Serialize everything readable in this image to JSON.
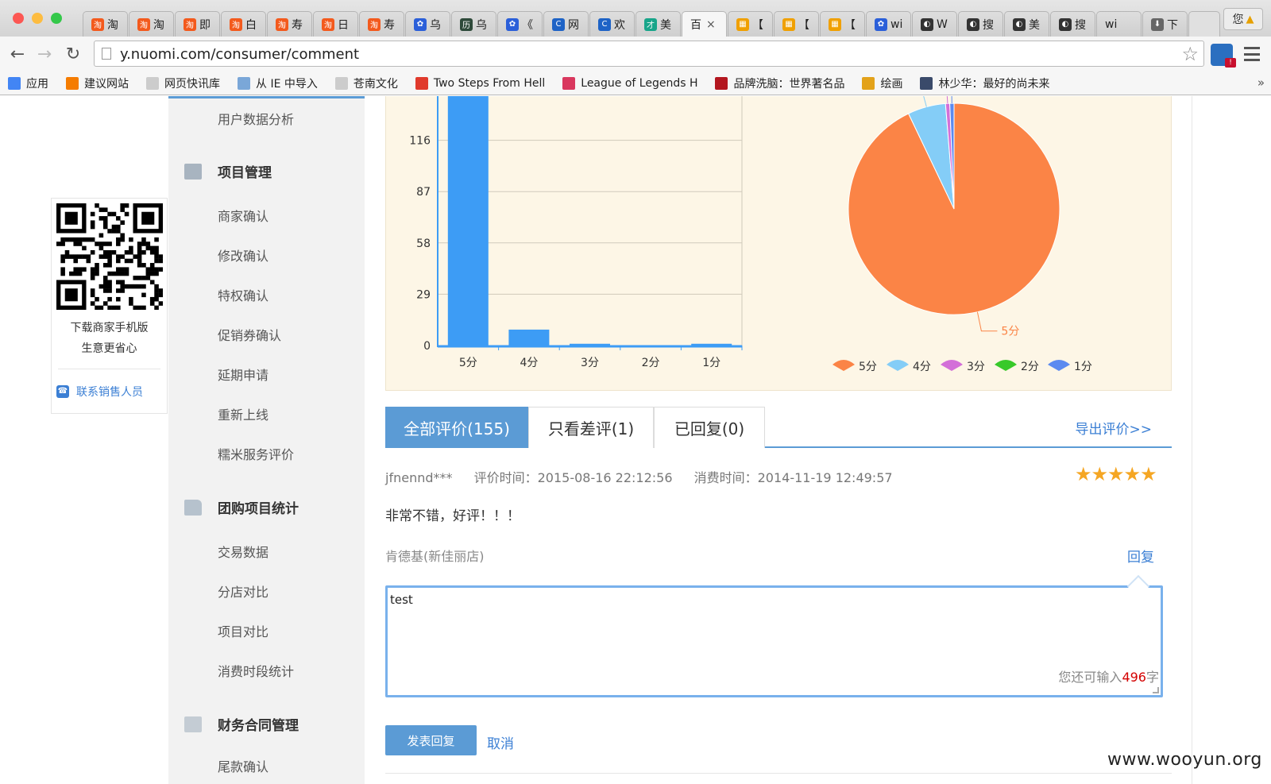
{
  "browser": {
    "tabs": [
      {
        "label": "淘",
        "fav_color": "#f35a1d",
        "fav_glyph": "淘"
      },
      {
        "label": "淘",
        "fav_color": "#f35a1d",
        "fav_glyph": "淘"
      },
      {
        "label": "即",
        "fav_color": "#f35a1d",
        "fav_glyph": "淘"
      },
      {
        "label": "白",
        "fav_color": "#f35a1d",
        "fav_glyph": "淘"
      },
      {
        "label": "寿",
        "fav_color": "#f35a1d",
        "fav_glyph": "淘"
      },
      {
        "label": "日",
        "fav_color": "#f35a1d",
        "fav_glyph": "淘"
      },
      {
        "label": "寿",
        "fav_color": "#f35a1d",
        "fav_glyph": "淘"
      },
      {
        "label": "乌",
        "fav_color": "#2b5fd9",
        "fav_glyph": "✿"
      },
      {
        "label": "乌",
        "fav_color": "#2e4a3a",
        "fav_glyph": "历"
      },
      {
        "label": "《",
        "fav_color": "#2b5fd9",
        "fav_glyph": "✿"
      },
      {
        "label": "网",
        "fav_color": "#1e63c6",
        "fav_glyph": "C"
      },
      {
        "label": "欢",
        "fav_color": "#1e63c6",
        "fav_glyph": "C"
      },
      {
        "label": "美",
        "fav_color": "#18a58a",
        "fav_glyph": "才"
      },
      {
        "label": "百",
        "fav_color": "",
        "fav_glyph": "",
        "active": true,
        "close": "×"
      },
      {
        "label": "【",
        "fav_color": "#f0a000",
        "fav_glyph": "▦"
      },
      {
        "label": "【",
        "fav_color": "#f0a000",
        "fav_glyph": "▦"
      },
      {
        "label": "【",
        "fav_color": "#f0a000",
        "fav_glyph": "▦"
      },
      {
        "label": "wi",
        "fav_color": "#2b5fd9",
        "fav_glyph": "✿"
      },
      {
        "label": "W",
        "fav_color": "#333333",
        "fav_glyph": "◐"
      },
      {
        "label": "搜",
        "fav_color": "#333333",
        "fav_glyph": "◐"
      },
      {
        "label": "美",
        "fav_color": "#333333",
        "fav_glyph": "◐"
      },
      {
        "label": "搜",
        "fav_color": "#333333",
        "fav_glyph": "◐"
      },
      {
        "label": "wi",
        "fav_color": "",
        "fav_glyph": ""
      },
      {
        "label": "下",
        "fav_color": "#666666",
        "fav_glyph": "⬇"
      }
    ],
    "user_chip": "您",
    "url": "y.nuomi.com/consumer/comment",
    "bookmarks": [
      {
        "label": "应用",
        "icon_color": "#4285f4"
      },
      {
        "label": "建议网站",
        "icon_color": "#f57c00"
      },
      {
        "label": "网页快讯库",
        "icon_color": "#cccccc"
      },
      {
        "label": "从 IE 中导入",
        "icon_color": "#7aa7d8"
      },
      {
        "label": "苍南文化",
        "icon_color": "#cccccc"
      },
      {
        "label": "Two Steps From Hell",
        "icon_color": "#e03a2c"
      },
      {
        "label": "League of Legends H",
        "icon_color": "#d9375e"
      },
      {
        "label": "品牌洗脑：世界著名品",
        "icon_color": "#b3161f"
      },
      {
        "label": "绘画",
        "icon_color": "#e3a21a"
      },
      {
        "label": "林少华：最好的尚未来",
        "icon_color": "#3a4a6a"
      }
    ],
    "bookmarks_more": "»"
  },
  "sidebar_promo": {
    "line1": "下载商家手机版",
    "line2": "生意更省心",
    "contact_label": "联系销售人员"
  },
  "sidebar": {
    "top_item": "用户数据分析",
    "groups": [
      {
        "title": "项目管理",
        "items": [
          "商家确认",
          "修改确认",
          "特权确认",
          "促销券确认",
          "延期申请",
          "重新上线",
          "糯米服务评价"
        ]
      },
      {
        "title": "团购项目统计",
        "items": [
          "交易数据",
          "分店对比",
          "项目对比",
          "消费时段统计"
        ]
      },
      {
        "title": "财务合同管理",
        "items": [
          "尾款确认"
        ]
      }
    ]
  },
  "chart_data": [
    {
      "type": "bar",
      "categories": [
        "5分",
        "4分",
        "3分",
        "2分",
        "1分"
      ],
      "values": [
        144,
        9,
        1,
        0,
        1
      ],
      "yticks": [
        0,
        29,
        58,
        87,
        116
      ],
      "ylim": [
        0,
        145
      ],
      "color": "#3d9cf5",
      "grid": true
    },
    {
      "type": "pie",
      "labels": [
        "5分",
        "4分",
        "3分",
        "2分",
        "1分"
      ],
      "values": [
        144,
        9,
        1,
        0,
        1
      ],
      "colors": [
        "#fb8446",
        "#84cdf7",
        "#d36fd8",
        "#38c92a",
        "#5b8af0"
      ],
      "data_label": "5分",
      "legend_position": "bottom"
    }
  ],
  "review_tabs": [
    {
      "label": "全部评价(155)",
      "active": true
    },
    {
      "label": "只看差评(1)",
      "active": false
    },
    {
      "label": "已回复(0)",
      "active": false
    }
  ],
  "export_label": "导出评价>>",
  "review": {
    "user": "jfnennd***",
    "review_time": "评价时间：2015-08-16 22:12:56",
    "consume_time": "消费时间：2014-11-19 12:49:57",
    "rating": 5,
    "stars": "★★★★★",
    "content": "非常不错，好评！！！",
    "shop": "肯德基(新佳丽店)",
    "reply_label": "回复"
  },
  "reply_form": {
    "value": "test",
    "remaining_prefix": "您还可输入",
    "remaining": "496",
    "remaining_suffix": "字",
    "submit_label": "发表回复",
    "cancel_label": "取消"
  },
  "watermark": "www.wooyun.org"
}
